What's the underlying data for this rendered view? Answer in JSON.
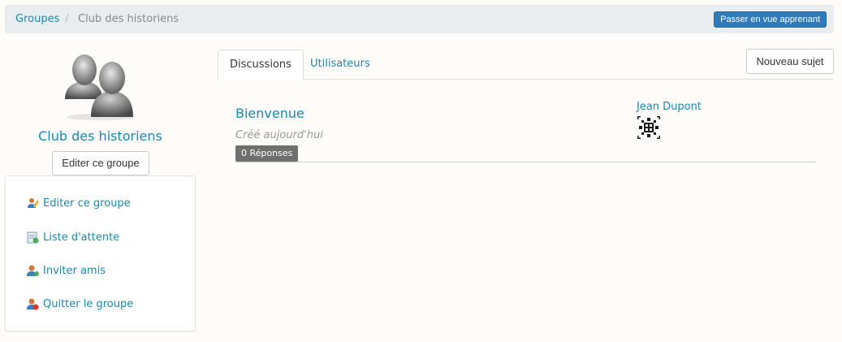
{
  "breadcrumb": {
    "root": "Groupes",
    "separator": "/",
    "current": "Club des historiens"
  },
  "header": {
    "learner_view_label": "Passer en vue apprenant"
  },
  "group": {
    "name": "Club des historiens",
    "edit_button_label": "Editer ce groupe",
    "avatar_icon": "group-avatar-icon"
  },
  "sidebar": {
    "items": [
      {
        "label": "Editer ce groupe",
        "icon": "edit-icon"
      },
      {
        "label": "Liste d'attente",
        "icon": "waiting-list-icon"
      },
      {
        "label": "Inviter amis",
        "icon": "invite-friends-icon"
      },
      {
        "label": "Quitter le groupe",
        "icon": "leave-group-icon"
      }
    ]
  },
  "tabs": [
    {
      "label": "Discussions",
      "active": true
    },
    {
      "label": "Utilisateurs",
      "active": false
    }
  ],
  "toolbar": {
    "new_topic_label": "Nouveau sujet"
  },
  "topics": [
    {
      "title": "Bienvenue",
      "created": "Créé aujourd'hui",
      "replies": "0 Réponses",
      "author": "Jean Dupont"
    }
  ],
  "colors": {
    "link": "#1c88b0",
    "primary_button": "#2f7ab9",
    "badge": "#6f6f6f"
  }
}
